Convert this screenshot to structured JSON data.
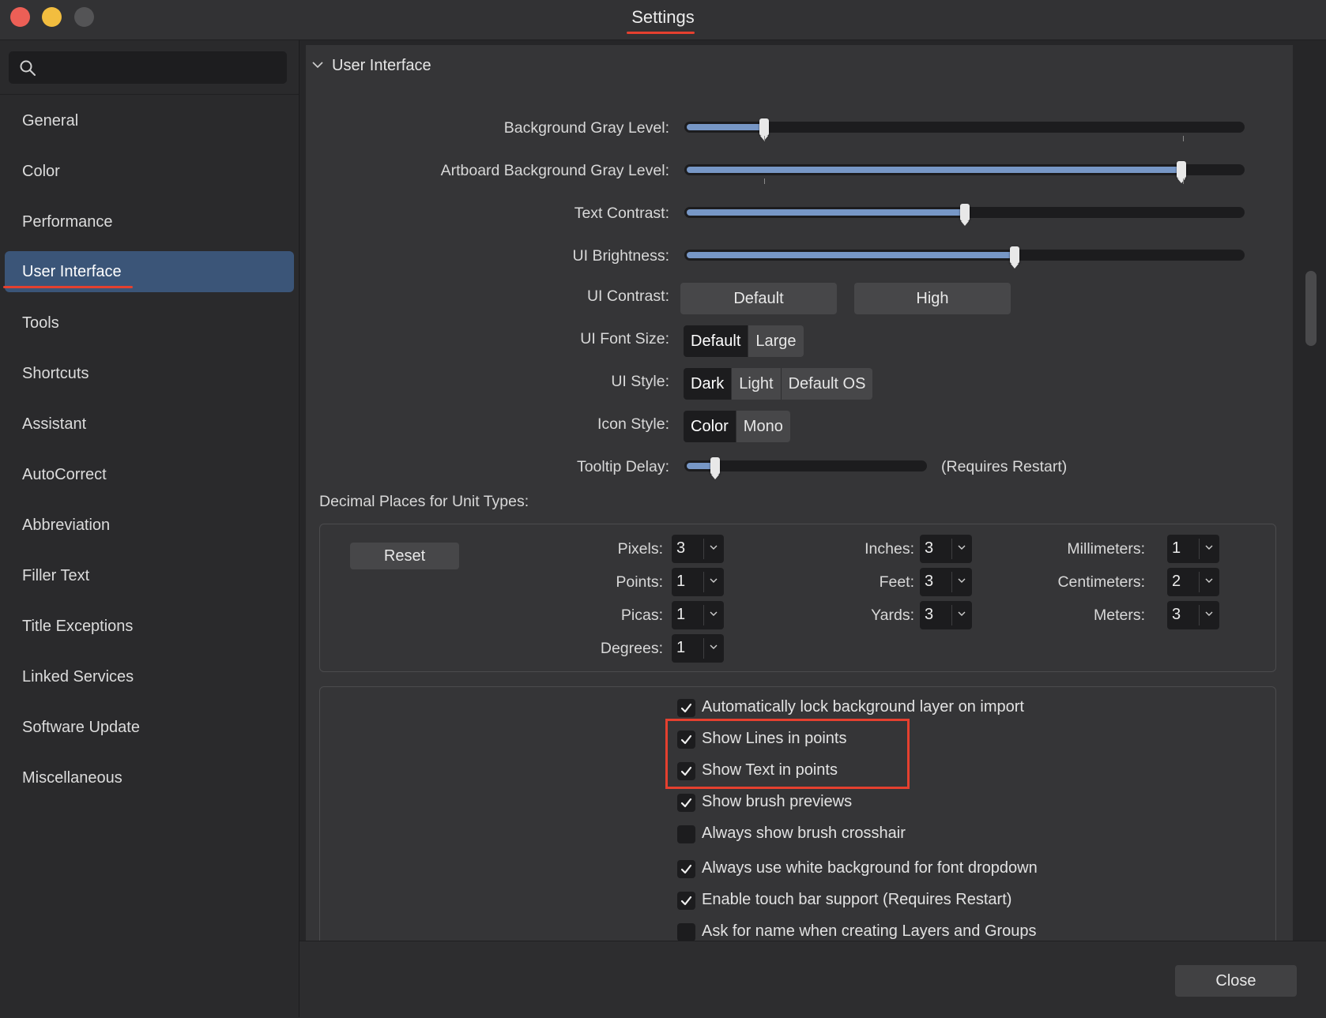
{
  "window": {
    "title": "Settings"
  },
  "search": {
    "placeholder": ""
  },
  "sidebar": {
    "items": [
      {
        "label": "General"
      },
      {
        "label": "Color"
      },
      {
        "label": "Performance"
      },
      {
        "label": "User Interface",
        "active": true
      },
      {
        "label": "Tools"
      },
      {
        "label": "Shortcuts"
      },
      {
        "label": "Assistant"
      },
      {
        "label": "AutoCorrect"
      },
      {
        "label": "Abbreviation"
      },
      {
        "label": "Filler Text"
      },
      {
        "label": "Title Exceptions"
      },
      {
        "label": "Linked Services"
      },
      {
        "label": "Software Update"
      },
      {
        "label": "Miscellaneous"
      }
    ]
  },
  "section": {
    "title": "User Interface"
  },
  "sliders": {
    "background_gray": {
      "label": "Background Gray Level:",
      "value": 0.14
    },
    "artboard_gray": {
      "label": "Artboard Background Gray Level:",
      "value": 0.89
    },
    "text_contrast": {
      "label": "Text Contrast:",
      "value": 0.5
    },
    "ui_brightness": {
      "label": "UI Brightness:",
      "value": 0.59
    },
    "tooltip_delay": {
      "label": "Tooltip Delay:",
      "value": 0.12,
      "note": "(Requires Restart)"
    }
  },
  "ui_contrast": {
    "label": "UI Contrast:",
    "options": [
      "Default",
      "High"
    ]
  },
  "ui_font_size": {
    "label": "UI Font Size:",
    "options": [
      "Default",
      "Large"
    ],
    "selected": "Default"
  },
  "ui_style": {
    "label": "UI Style:",
    "options": [
      "Dark",
      "Light",
      "Default OS"
    ],
    "selected": "Dark"
  },
  "icon_style": {
    "label": "Icon Style:",
    "options": [
      "Color",
      "Mono"
    ],
    "selected": "Color"
  },
  "decimal": {
    "title": "Decimal Places for Unit Types:",
    "reset_label": "Reset",
    "units": {
      "pixels": {
        "label": "Pixels:",
        "value": "3"
      },
      "points": {
        "label": "Points:",
        "value": "1"
      },
      "picas": {
        "label": "Picas:",
        "value": "1"
      },
      "degrees": {
        "label": "Degrees:",
        "value": "1"
      },
      "inches": {
        "label": "Inches:",
        "value": "3"
      },
      "feet": {
        "label": "Feet:",
        "value": "3"
      },
      "yards": {
        "label": "Yards:",
        "value": "3"
      },
      "millimeters": {
        "label": "Millimeters:",
        "value": "1"
      },
      "centimeters": {
        "label": "Centimeters:",
        "value": "2"
      },
      "meters": {
        "label": "Meters:",
        "value": "3"
      }
    }
  },
  "checkboxes": [
    {
      "label": "Automatically lock background layer on import",
      "checked": true
    },
    {
      "label": "Show Lines in points",
      "checked": true
    },
    {
      "label": "Show Text in points",
      "checked": true
    },
    {
      "label": "Show brush previews",
      "checked": true
    },
    {
      "label": "Always show brush crosshair",
      "checked": false
    },
    {
      "label": "Always use white background for font dropdown",
      "checked": true
    },
    {
      "label": "Enable touch bar support (Requires Restart)",
      "checked": true
    },
    {
      "label": "Ask for name when creating Layers and Groups",
      "checked": false
    }
  ],
  "footer": {
    "close_label": "Close"
  },
  "colors": {
    "accent": "#3b5578",
    "slider_fill": "#7797c6",
    "annotation": "#e5402f"
  }
}
